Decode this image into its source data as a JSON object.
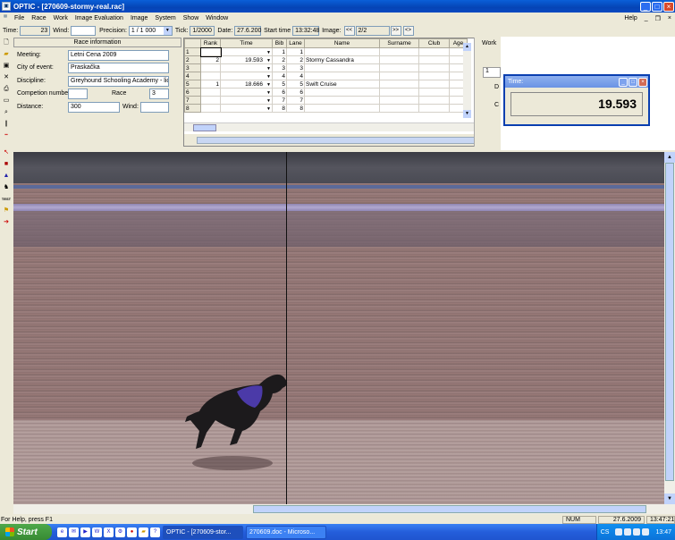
{
  "window": {
    "title": "OPTIC - [270609-stormy-real.rac]"
  },
  "menu": {
    "items": [
      "File",
      "Race",
      "Work",
      "Image Evaluation",
      "Image",
      "System",
      "Show",
      "Window"
    ],
    "help": "Help"
  },
  "toolbar": {
    "time_label": "Time:",
    "time_value": "23",
    "wind_label": "Wind:",
    "wind_value": "",
    "precision_label": "Precision:",
    "precision_value": "1 / 1 000",
    "tick_label": "Tick:",
    "tick_value": "1/2000",
    "date_label": "Date:",
    "date_value": "27.6.200",
    "start_time_label": "Start time",
    "start_time_value": "13:32:48",
    "image_label": "Image:",
    "prev_label": "<<",
    "image_value": "2/2",
    "next_label": ">>",
    "end_label": "<>"
  },
  "race_info": {
    "header": "Race information",
    "meeting_label": "Meeting:",
    "meeting_value": "Letni Cena 2009",
    "city_label": "City of event:",
    "city_value": "Praskačka",
    "discipline_label": "Discipline:",
    "discipline_value": "Greyhound Schooling Academy - licen",
    "competition_label": "Competion number:",
    "competition_value": "",
    "race_label": "Race",
    "race_value": "3",
    "distance_label": "Distance:",
    "distance_value": "300",
    "wind_label": "Wind:",
    "wind_value": ""
  },
  "results": {
    "columns": [
      "Rank",
      "Time",
      "Bib",
      "Lane",
      "Name",
      "Surname",
      "Club",
      "Age"
    ],
    "rows": [
      {
        "n": "1",
        "rank": "",
        "time": "",
        "bib": "1",
        "lane": "1",
        "name": ""
      },
      {
        "n": "2",
        "rank": "2",
        "time": "19.593",
        "bib": "2",
        "lane": "2",
        "name": "Stormy Cassandra"
      },
      {
        "n": "3",
        "rank": "",
        "time": "",
        "bib": "3",
        "lane": "3",
        "name": ""
      },
      {
        "n": "4",
        "rank": "",
        "time": "",
        "bib": "4",
        "lane": "4",
        "name": ""
      },
      {
        "n": "5",
        "rank": "1",
        "time": "18.666",
        "bib": "5",
        "lane": "5",
        "name": "Swift Cruise"
      },
      {
        "n": "6",
        "rank": "",
        "time": "",
        "bib": "6",
        "lane": "6",
        "name": ""
      },
      {
        "n": "7",
        "rank": "",
        "time": "",
        "bib": "7",
        "lane": "7",
        "name": ""
      },
      {
        "n": "8",
        "rank": "",
        "time": "",
        "bib": "8",
        "lane": "8",
        "name": ""
      }
    ]
  },
  "work_panel": {
    "label": "Work",
    "b1": "1",
    "b2": "D",
    "b3": "C"
  },
  "time_window": {
    "title": "Time:",
    "value": "19.593"
  },
  "status_bar": {
    "help_text": "For Help, press F1",
    "num": "NUM",
    "date": "27.6.2009",
    "time": "13:47:21"
  },
  "taskbar": {
    "start": "Start",
    "tasks": [
      "OPTIC - [270609-stor...",
      "270609.doc - Microso..."
    ],
    "lang": "CS",
    "clock": "13:47"
  },
  "colors": {
    "title_blue": "#0544b5",
    "taskbar_blue": "#245edb",
    "start_green": "#378a33",
    "dog_color": "#1c1a1c",
    "dog_vest": "#4b3aa8"
  }
}
